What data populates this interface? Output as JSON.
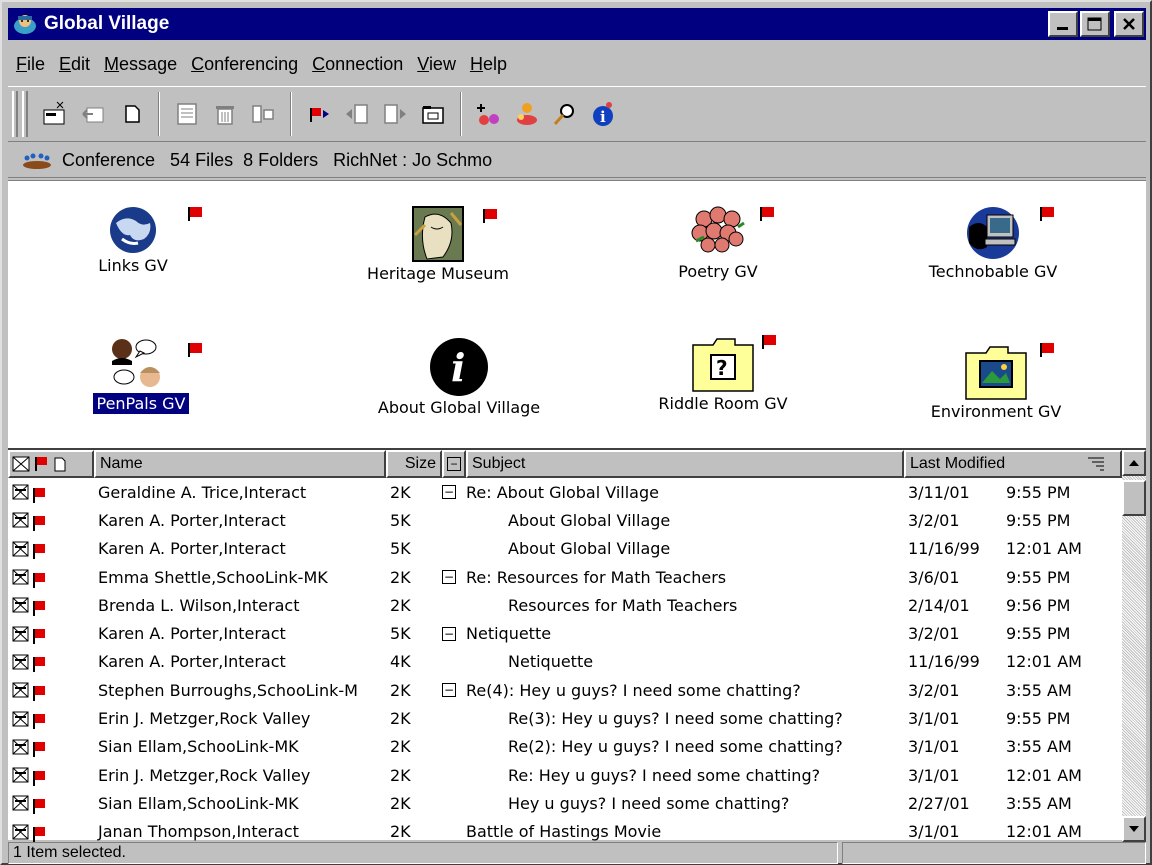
{
  "window": {
    "title": "Global Village",
    "app_icon": "global-village-icon"
  },
  "titlebar_buttons": [
    {
      "name": "minimize-icon",
      "glyph": "▁"
    },
    {
      "name": "maximize-icon",
      "glyph": "□"
    },
    {
      "name": "close-icon",
      "glyph": "✕"
    }
  ],
  "menu": [
    {
      "label": "File",
      "u": "F",
      "rest": "ile"
    },
    {
      "label": "Edit",
      "u": "E",
      "rest": "dit"
    },
    {
      "label": "Message",
      "u": "M",
      "rest": "essage"
    },
    {
      "label": "Conferencing",
      "u": "C",
      "rest": "onferencing"
    },
    {
      "label": "Connection",
      "u": "C",
      "rest": "onnection"
    },
    {
      "label": "View",
      "u": "V",
      "rest": "iew"
    },
    {
      "label": "Help",
      "u": "H",
      "rest": "elp"
    }
  ],
  "statusline": {
    "icon": "conference-icon",
    "text": "Conference   54 Files  8 Folders   RichNet : Jo Schmo"
  },
  "folders": [
    {
      "label": "Links GV",
      "icon": "globe-icon",
      "selected": false
    },
    {
      "label": "Heritage Museum",
      "icon": "heritage-painting-icon",
      "selected": false
    },
    {
      "label": "Poetry GV",
      "icon": "flower-bouquet-icon",
      "selected": false
    },
    {
      "label": "Technobable GV",
      "icon": "computer-globe-icon",
      "selected": false
    },
    {
      "label": "PenPals GV",
      "icon": "people-chatting-icon",
      "selected": true
    },
    {
      "label": "About Global Village",
      "icon": "info-icon",
      "selected": false
    },
    {
      "label": "Riddle Room GV",
      "icon": "question-folder-icon",
      "selected": false
    },
    {
      "label": "Environment GV",
      "icon": "picture-folder-icon",
      "selected": false
    }
  ],
  "list": {
    "headers": {
      "name": "Name",
      "size": "Size",
      "subject": "Subject",
      "modified": "Last Modified"
    },
    "rows": [
      {
        "name": "Geraldine A. Trice,Interact",
        "size": "2K",
        "thread": true,
        "subject": "Re: About Global Village",
        "indent": false,
        "date": "3/11/01",
        "time": "9:55 PM"
      },
      {
        "name": "Karen A. Porter,Interact",
        "size": "5K",
        "thread": false,
        "subject": "About Global Village",
        "indent": true,
        "date": "3/2/01",
        "time": "9:55 PM"
      },
      {
        "name": "Karen A. Porter,Interact",
        "size": "5K",
        "thread": false,
        "subject": "About Global Village",
        "indent": true,
        "date": "11/16/99",
        "time": "12:01 AM"
      },
      {
        "name": "Emma Shettle,SchooLink-MK",
        "size": "2K",
        "thread": true,
        "subject": "Re: Resources for Math Teachers",
        "indent": false,
        "date": "3/6/01",
        "time": "9:55 PM"
      },
      {
        "name": "Brenda L. Wilson,Interact",
        "size": "2K",
        "thread": false,
        "subject": "Resources for Math Teachers",
        "indent": true,
        "date": "2/14/01",
        "time": "9:56 PM"
      },
      {
        "name": "Karen A. Porter,Interact",
        "size": "5K",
        "thread": true,
        "subject": "Netiquette",
        "indent": false,
        "date": "3/2/01",
        "time": "9:55 PM"
      },
      {
        "name": "Karen A. Porter,Interact",
        "size": "4K",
        "thread": false,
        "subject": "Netiquette",
        "indent": true,
        "date": "11/16/99",
        "time": "12:01 AM"
      },
      {
        "name": "Stephen Burroughs,SchooLink-M",
        "size": "2K",
        "thread": true,
        "subject": "Re(4): Hey u guys? I need some chatting?",
        "indent": false,
        "date": "3/2/01",
        "time": "3:55 AM"
      },
      {
        "name": "Erin J. Metzger,Rock Valley",
        "size": "2K",
        "thread": false,
        "subject": "Re(3): Hey u guys? I need some chatting?",
        "indent": true,
        "date": "3/1/01",
        "time": "9:55 PM"
      },
      {
        "name": "Sian Ellam,SchooLink-MK",
        "size": "2K",
        "thread": false,
        "subject": "Re(2): Hey u guys? I need some chatting?",
        "indent": true,
        "date": "3/1/01",
        "time": "3:55 AM"
      },
      {
        "name": "Erin J. Metzger,Rock Valley",
        "size": "2K",
        "thread": false,
        "subject": "Re: Hey u guys? I need some chatting?",
        "indent": true,
        "date": "3/1/01",
        "time": "12:01 AM"
      },
      {
        "name": "Sian Ellam,SchooLink-MK",
        "size": "2K",
        "thread": false,
        "subject": "Hey u guys? I need some chatting?",
        "indent": true,
        "date": "2/27/01",
        "time": "3:55 AM"
      },
      {
        "name": "Janan Thompson,Interact",
        "size": "2K",
        "thread": false,
        "subject": "Battle of Hastings Movie",
        "indent": false,
        "date": "3/1/01",
        "time": "12:01 AM"
      }
    ]
  },
  "statusbar": {
    "text": "1 Item selected.",
    "right": ""
  },
  "colors": {
    "titlebar": "#000080",
    "face": "#c0c0c0",
    "flag": "#e00000",
    "selection": "#000080"
  }
}
